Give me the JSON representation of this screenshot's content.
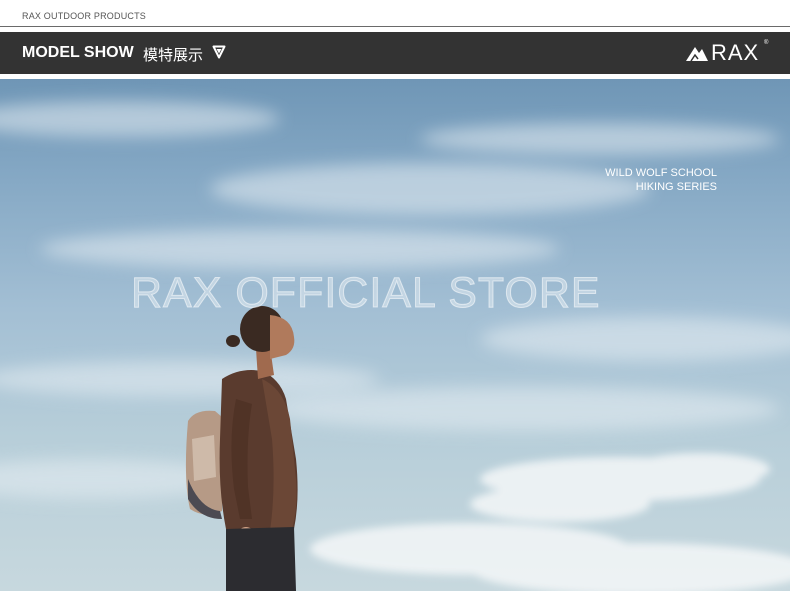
{
  "header": {
    "brand_line": "RAX OUTDOOR PRODUCTS"
  },
  "bar": {
    "title": "MODEL SHOW",
    "title_cn": "模特展示",
    "dropdown_icon": "triangle-down-icon",
    "logo_text": "RAX",
    "logo_reg": "®",
    "logo_icon": "mountain-logo-icon"
  },
  "hero": {
    "series_line1": "WILD WOLF SCHOOL",
    "series_line2": "HIKING SERIES",
    "watermark": "RAX OFFICIAL STORE"
  }
}
